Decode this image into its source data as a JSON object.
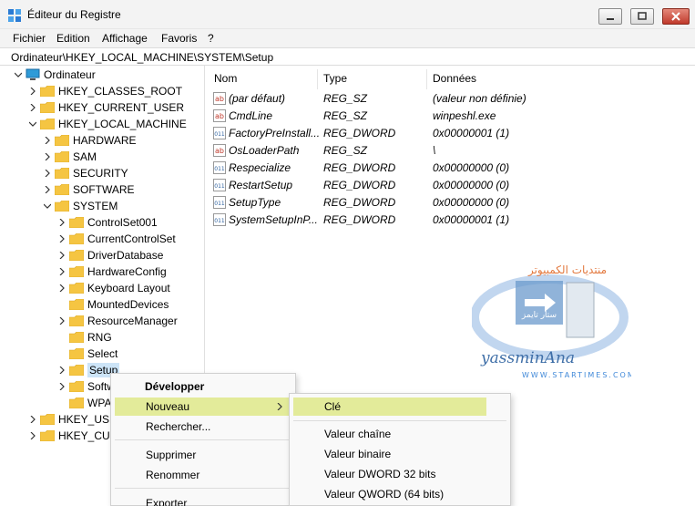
{
  "window": {
    "title": "Éditeur du Registre"
  },
  "menu": {
    "items": [
      "Fichier",
      "Edition",
      "Affichage",
      "Favoris",
      "?"
    ]
  },
  "address": {
    "path": "Ordinateur\\HKEY_LOCAL_MACHINE\\SYSTEM\\Setup"
  },
  "tree": {
    "root": "Ordinateur",
    "nodes": [
      {
        "label": "HKEY_CLASSES_ROOT"
      },
      {
        "label": "HKEY_CURRENT_USER"
      },
      {
        "label": "HKEY_LOCAL_MACHINE"
      },
      {
        "label": "HARDWARE"
      },
      {
        "label": "SAM"
      },
      {
        "label": "SECURITY"
      },
      {
        "label": "SOFTWARE"
      },
      {
        "label": "SYSTEM"
      },
      {
        "label": "ControlSet001"
      },
      {
        "label": "CurrentControlSet"
      },
      {
        "label": "DriverDatabase"
      },
      {
        "label": "HardwareConfig"
      },
      {
        "label": "Keyboard Layout"
      },
      {
        "label": "MountedDevices"
      },
      {
        "label": "ResourceManager"
      },
      {
        "label": "RNG"
      },
      {
        "label": "Select"
      },
      {
        "label": "Setup"
      },
      {
        "label": "Softw"
      },
      {
        "label": "WPA"
      },
      {
        "label": "HKEY_USEI"
      },
      {
        "label": "HKEY_CUR"
      }
    ]
  },
  "list": {
    "headers": {
      "name": "Nom",
      "type": "Type",
      "data": "Données"
    },
    "rows": [
      {
        "name": "(par défaut)",
        "type": "REG_SZ",
        "data": "(valeur non définie)",
        "icon": "string-value-icon"
      },
      {
        "name": "CmdLine",
        "type": "REG_SZ",
        "data": "winpeshl.exe",
        "icon": "string-value-icon"
      },
      {
        "name": "FactoryPreInstall...",
        "type": "REG_DWORD",
        "data": "0x00000001 (1)",
        "icon": "binary-value-icon"
      },
      {
        "name": "OsLoaderPath",
        "type": "REG_SZ",
        "data": "\\",
        "icon": "string-value-icon"
      },
      {
        "name": "Respecialize",
        "type": "REG_DWORD",
        "data": "0x00000000 (0)",
        "icon": "binary-value-icon"
      },
      {
        "name": "RestartSetup",
        "type": "REG_DWORD",
        "data": "0x00000000 (0)",
        "icon": "binary-value-icon"
      },
      {
        "name": "SetupType",
        "type": "REG_DWORD",
        "data": "0x00000000 (0)",
        "icon": "binary-value-icon"
      },
      {
        "name": "SystemSetupInP...",
        "type": "REG_DWORD",
        "data": "0x00000001 (1)",
        "icon": "binary-value-icon"
      }
    ]
  },
  "watermark": {
    "arabic": "منتديات الكمبيوتر",
    "arabic2": "ستار تايمز",
    "brand": "yassminAna",
    "site": "WWW.STARTIMES.COM"
  },
  "context_menu": {
    "items": [
      "Développer",
      "Nouveau",
      "Rechercher...",
      "Supprimer",
      "Renommer",
      "Exporter"
    ]
  },
  "submenu": {
    "items": [
      "Clé",
      "Valeur chaîne",
      "Valeur binaire",
      "Valeur DWORD 32 bits",
      "Valeur QWORD (64 bits)"
    ]
  },
  "colors": {
    "highlight": "#e3eb9a",
    "folder": "#f5c542",
    "selection": "#cce4f7",
    "accent": "#1e6fd0"
  }
}
